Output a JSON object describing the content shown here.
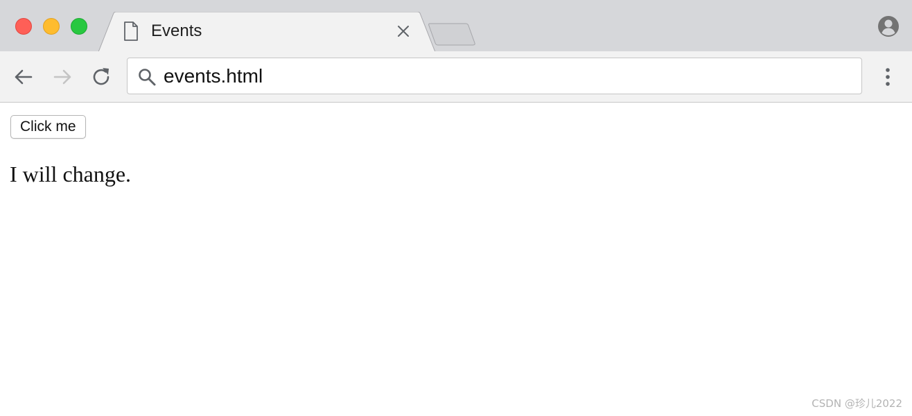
{
  "tab": {
    "title": "Events",
    "icon": "file-icon"
  },
  "toolbar": {
    "address": "events.html",
    "back_icon": "arrow-left-icon",
    "forward_icon": "arrow-right-icon",
    "reload_icon": "reload-icon",
    "search_icon": "search-icon",
    "menu_icon": "vertical-dots-icon"
  },
  "page": {
    "button_label": "Click me",
    "paragraph": "I will change."
  },
  "watermark": "CSDN @珍儿2022",
  "colors": {
    "close": "#fe5f57",
    "minimize": "#febc2e",
    "maximize": "#28c840",
    "tabstrip": "#d6d7da",
    "toolbar": "#f2f2f2"
  }
}
